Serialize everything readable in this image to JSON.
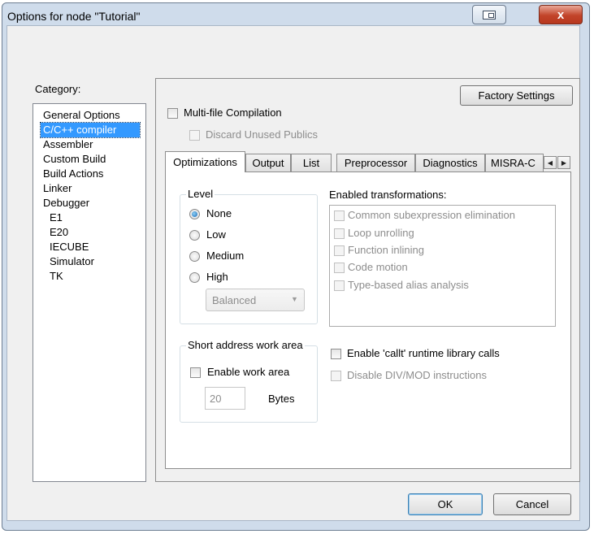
{
  "window": {
    "title": "Options for node \"Tutorial\"",
    "close_glyph": "x"
  },
  "category": {
    "label": "Category:",
    "items": [
      {
        "label": "General Options",
        "indent": 0
      },
      {
        "label": "C/C++ compiler",
        "indent": 0,
        "selected": true
      },
      {
        "label": "Assembler",
        "indent": 0
      },
      {
        "label": "Custom Build",
        "indent": 0
      },
      {
        "label": "Build Actions",
        "indent": 0
      },
      {
        "label": "Linker",
        "indent": 0
      },
      {
        "label": "Debugger",
        "indent": 0
      },
      {
        "label": "E1",
        "indent": 1
      },
      {
        "label": "E20",
        "indent": 1
      },
      {
        "label": "IECUBE",
        "indent": 1
      },
      {
        "label": "Simulator",
        "indent": 1
      },
      {
        "label": "TK",
        "indent": 1
      }
    ]
  },
  "panel": {
    "factory_settings": "Factory Settings",
    "multi_file": "Multi-file Compilation",
    "discard_unused": "Discard Unused Publics"
  },
  "tabs": [
    "Optimizations",
    "Output",
    "List",
    "Preprocessor",
    "Diagnostics",
    "MISRA-C"
  ],
  "optimizations": {
    "level_title": "Level",
    "levels": [
      "None",
      "Low",
      "Medium",
      "High"
    ],
    "selected_level": "None",
    "balanced": "Balanced",
    "transformations_title": "Enabled transformations:",
    "transformations": [
      "Common subexpression elimination",
      "Loop unrolling",
      "Function inlining",
      "Code motion",
      "Type-based alias analysis"
    ],
    "short_address_title": "Short address work area",
    "enable_work_area": "Enable work area",
    "work_area_value": "20",
    "bytes_label": "Bytes",
    "enable_callt": "Enable 'callt' runtime library calls",
    "disable_divmod": "Disable DIV/MOD instructions"
  },
  "footer": {
    "ok": "OK",
    "cancel": "Cancel"
  },
  "colors": {
    "selection": "#3399ff",
    "frame": "#cfdceb",
    "close": "#c2442a"
  }
}
